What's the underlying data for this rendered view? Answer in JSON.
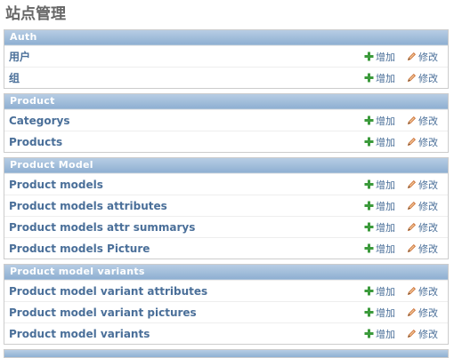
{
  "page": {
    "title": "站点管理"
  },
  "actions": {
    "add": "增加",
    "change": "修改"
  },
  "modules": [
    {
      "caption": "Auth",
      "items": [
        {
          "name": "用户"
        },
        {
          "name": "组"
        }
      ]
    },
    {
      "caption": "Product",
      "items": [
        {
          "name": "Categorys"
        },
        {
          "name": "Products"
        }
      ]
    },
    {
      "caption": "Product Model",
      "items": [
        {
          "name": "Product models"
        },
        {
          "name": "Product models attributes"
        },
        {
          "name": "Product models attr summarys"
        },
        {
          "name": "Product models Picture"
        }
      ]
    },
    {
      "caption": "Product model variants",
      "items": [
        {
          "name": "Product model variant attributes"
        },
        {
          "name": "Product model variant pictures"
        },
        {
          "name": "Product model variants"
        }
      ]
    }
  ],
  "colors": {
    "caption_bg": "#9fbedd",
    "link": "#4a6f99",
    "add_icon": "#3b9a3b",
    "change_icon": "#d07a2c"
  }
}
